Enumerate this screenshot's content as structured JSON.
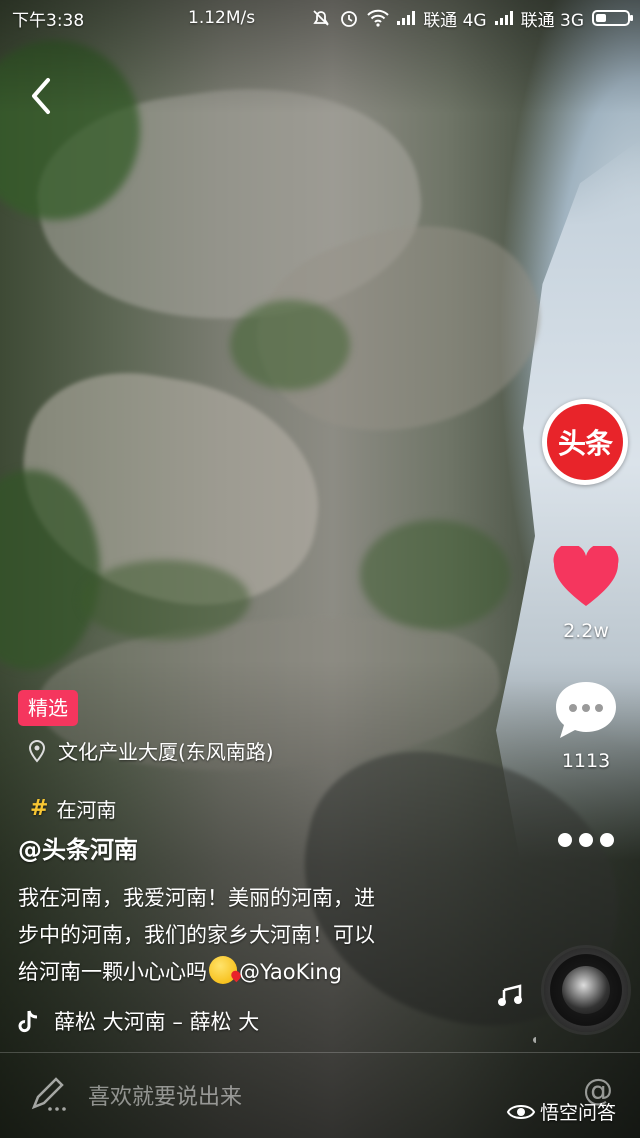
{
  "status_bar": {
    "time": "下午3:38",
    "network_speed": "1.12M/s",
    "carrier1": "联通 4G",
    "carrier2": "联通 3G"
  },
  "right_rail": {
    "brand_logo_text": "头条",
    "like_count": "2.2w",
    "comment_count": "1113"
  },
  "video_info": {
    "featured_tag": "精选",
    "location": "文化产业大厦(东风南路)",
    "topic": "在河南",
    "author": "@头条河南",
    "description_line1": "我在河南，我爱河南！美丽的河南，进",
    "description_line2": "步中的河南，我们的家乡大河南！可以",
    "description_line3_text": "给河南一颗小心心吗",
    "description_mention": "@YaoKing",
    "music_title": "薛松    大河南 – 薛松    大"
  },
  "comment_bar": {
    "placeholder": "喜欢就要说出来"
  },
  "watermark": {
    "text": "悟空问答"
  },
  "colors": {
    "featured_tag_bg": "#f5365e",
    "heart": "#f5365e",
    "topic_hash": "#f7c633",
    "brand_red": "#e8242a"
  },
  "icons": [
    "back-icon",
    "heart-icon",
    "comment-icon",
    "more-icon",
    "location-icon",
    "music-icon",
    "pencil-icon",
    "at-icon",
    "music-notes-icon"
  ]
}
